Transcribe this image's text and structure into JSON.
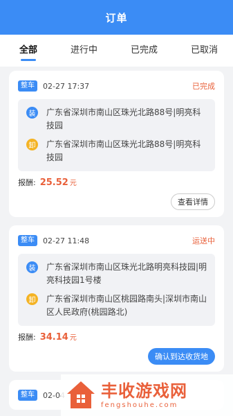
{
  "header": {
    "title": "订单"
  },
  "tabs": [
    {
      "label": "全部"
    },
    {
      "label": "进行中"
    },
    {
      "label": "已完成"
    },
    {
      "label": "已取消"
    }
  ],
  "orders": [
    {
      "type": "整车",
      "datetime": "02-27 17:37",
      "status": "已完成",
      "load_icon": "装",
      "load_address": "广东省深圳市南山区珠光北路88号|明亮科技园",
      "unload_icon": "卸",
      "unload_address": "广东省深圳市南山区珠光北路88号|明亮科技园",
      "fee_label": "报酬:",
      "fee": "25.52",
      "fee_unit": "元",
      "action": "查看详情"
    },
    {
      "type": "整车",
      "datetime": "02-27 11:48",
      "status": "运送中",
      "load_icon": "装",
      "load_address": "广东省深圳市南山区珠光北路明亮科技园|明亮科技园1号楼",
      "unload_icon": "卸",
      "unload_address": "广东省深圳市南山区桃园路南头|深圳市南山区人民政府(桃园路北)",
      "fee_label": "报酬:",
      "fee": "34.14",
      "fee_unit": "元",
      "action": "确认到达收货地"
    },
    {
      "type": "整车",
      "datetime": "02-04"
    }
  ],
  "watermark": {
    "title": "丰收游戏网",
    "subtitle": "fengshouhe.com",
    "color": "#e9603a"
  },
  "colors": {
    "primary": "#3b8cf5",
    "accent": "#e9603a",
    "unload": "#f4b324"
  }
}
